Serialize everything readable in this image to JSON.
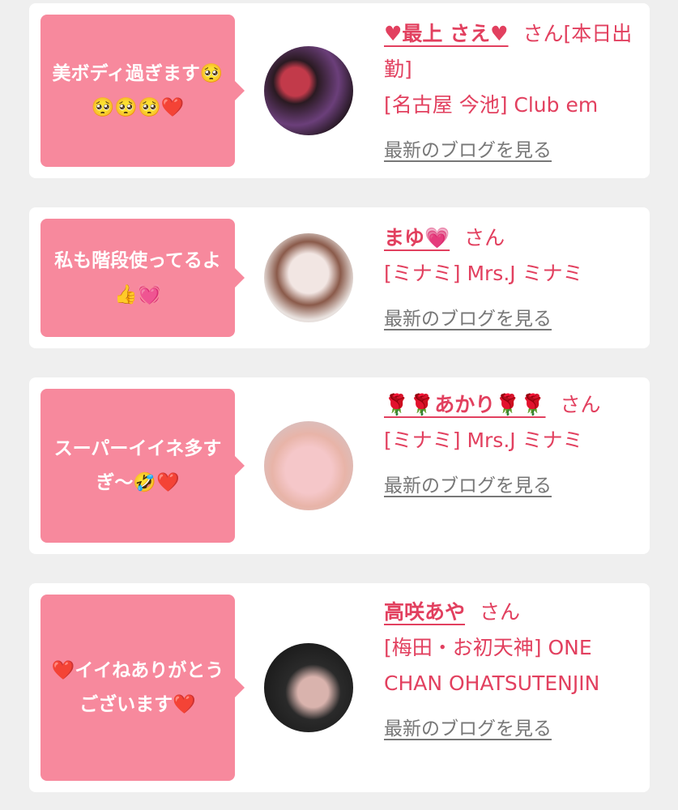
{
  "items": [
    {
      "comment": "美ボディ過ぎます🥺🥺🥺🥺❤️",
      "name": "♥最上 さえ♥",
      "honorific": "さん[本日出勤]",
      "shop": "[名古屋 今池] Club em",
      "blog_link": "最新のブログを見る"
    },
    {
      "comment": "私も階段使ってるよ👍💓",
      "name": "まゆ💗",
      "honorific": "さん",
      "shop": "[ミナミ] Mrs.J ミナミ",
      "blog_link": "最新のブログを見る"
    },
    {
      "comment": "スーパーイイネ多すぎ〜🤣❤️",
      "name": "🌹🌹あかり🌹🌹",
      "honorific": "さん",
      "shop": "[ミナミ] Mrs.J ミナミ",
      "blog_link": "最新のブログを見る"
    },
    {
      "comment": "❤️イイねありがとうございます❤️",
      "name": "高咲あや",
      "honorific": "さん",
      "shop": "[梅田・お初天神] ONE CHAN OHATSUTENJIN",
      "blog_link": "最新のブログを見る"
    }
  ],
  "colors": {
    "bubble": "#f7899d",
    "accent": "#e2405f",
    "link": "#777777",
    "background": "#efefef"
  }
}
